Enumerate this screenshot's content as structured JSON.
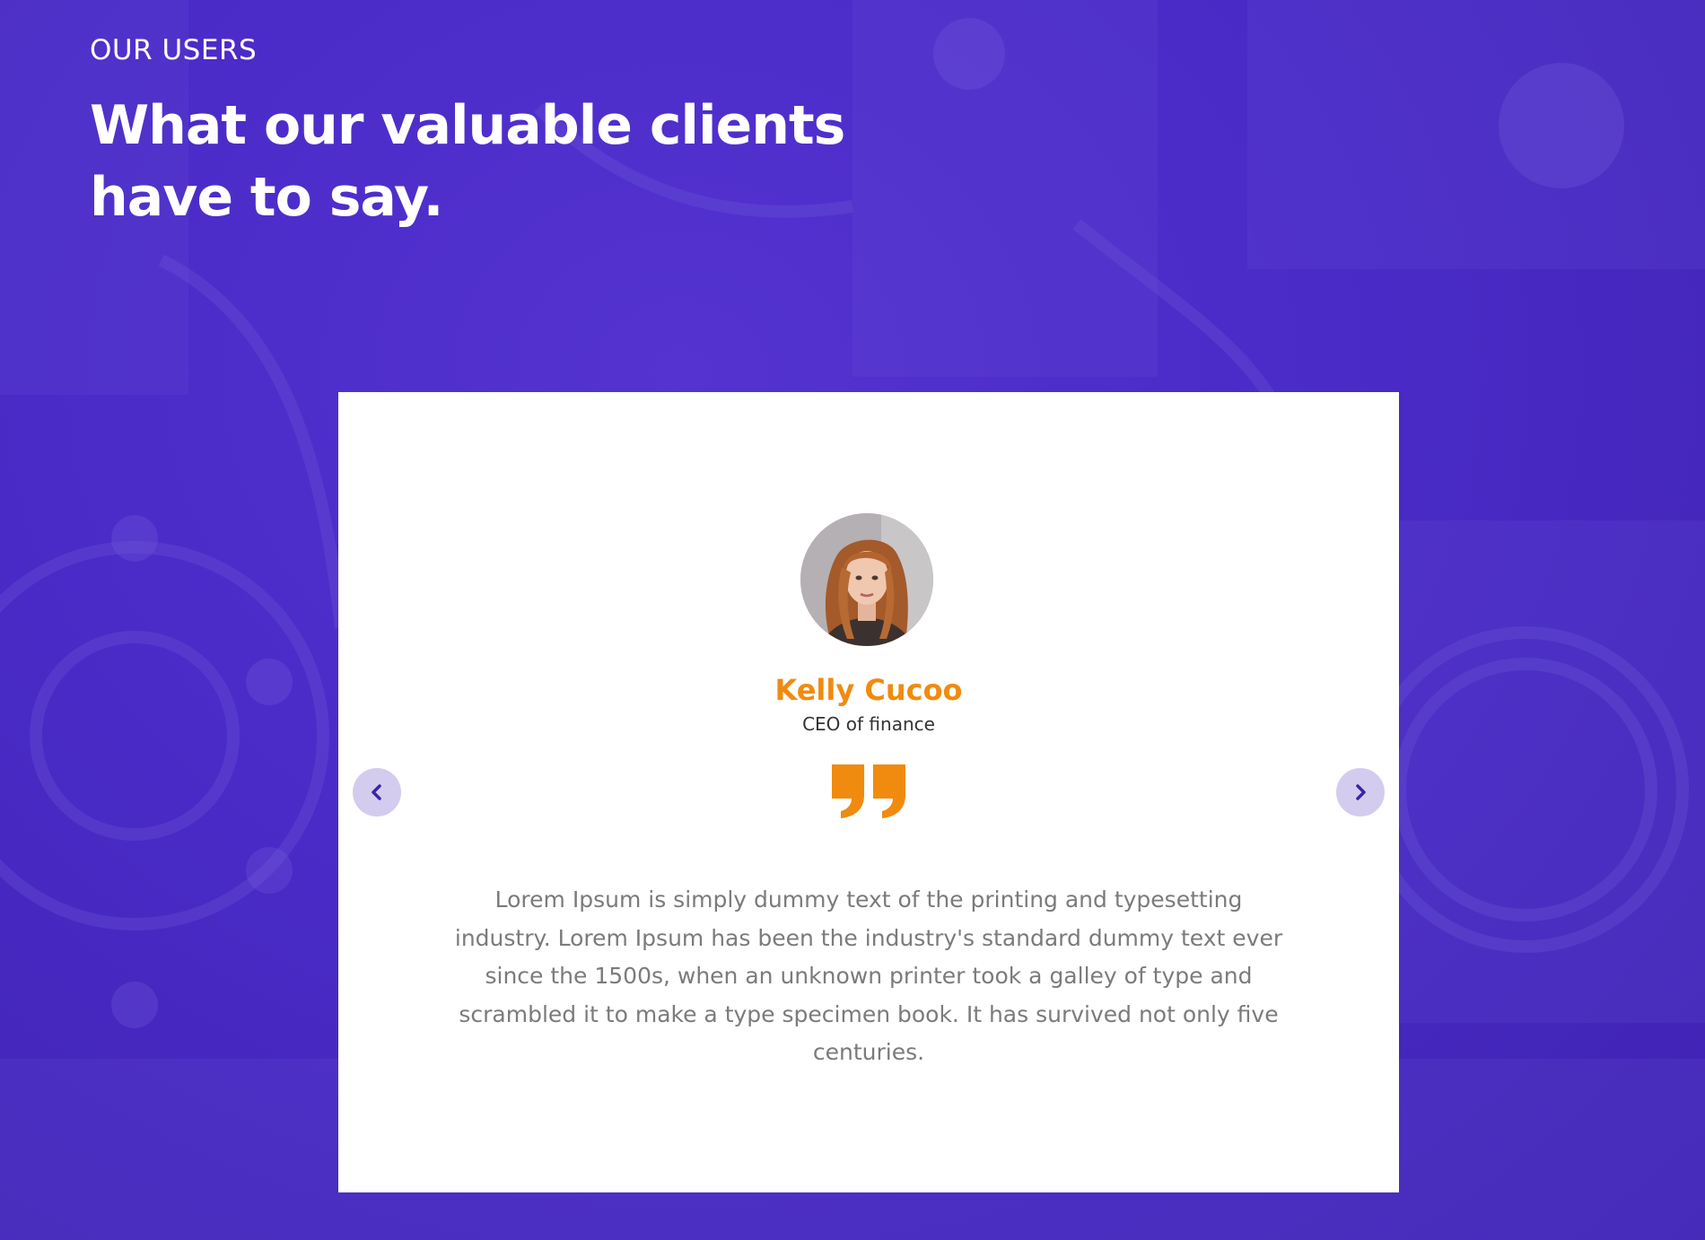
{
  "section": {
    "eyebrow": "OUR USERS",
    "title_line1": "What our valuable clients",
    "title_line2": "have to say."
  },
  "testimonial": {
    "name": "Kelly Cucoo",
    "role": "CEO of finance",
    "text": "Lorem Ipsum is simply dummy text of the printing and typesetting industry. Lorem Ipsum has been the industry's standard dummy text ever since the 1500s, when an unknown printer took a galley of type and scrambled it to make a type specimen book. It has survived not only five centuries.",
    "avatar_icon": "person-photo",
    "quote_icon": "quote-icon"
  },
  "navigation": {
    "prev_icon": "chevron-left-icon",
    "next_icon": "chevron-right-icon"
  },
  "colors": {
    "background": "#4a2bc7",
    "accent": "#f08b10",
    "card": "#ffffff",
    "nav_button": "#d3ccef",
    "nav_arrow": "#3b24a8",
    "body_text": "#7b7b7b"
  }
}
